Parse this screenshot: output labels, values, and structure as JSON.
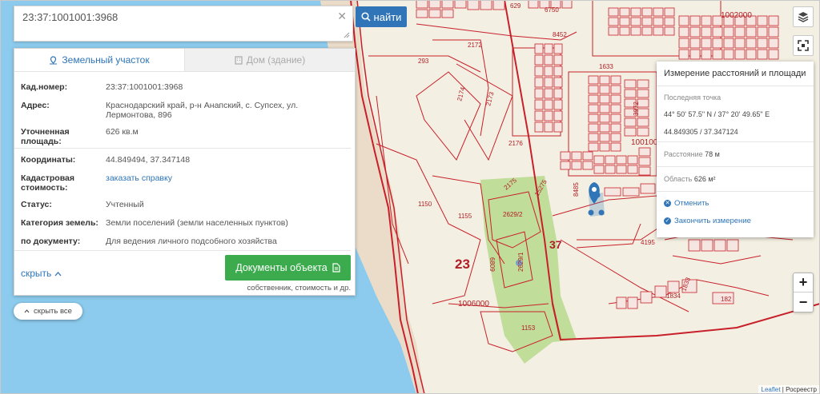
{
  "search": {
    "value": "23:37:1001001:3968",
    "button_label": "найти"
  },
  "tabs": {
    "parcel": "Земельный участок",
    "building": "Дом (здание)"
  },
  "parcel": {
    "cad_label": "Кад.номер:",
    "cad_value": "23:37:1001001:3968",
    "address_label": "Адрес:",
    "address_value": "Краснодарский край, р-н Анапский, с. Супсех, ул. Лермонтова, 896",
    "area_label": "Уточненная площадь:",
    "area_value": "626 кв.м",
    "coords_label": "Координаты:",
    "coords_value": "44.849494, 37.347148",
    "cost_label": "Кадастровая стоимость:",
    "cost_value": "заказать справку",
    "status_label": "Статус:",
    "status_value": "Учтенный",
    "category_label": "Категория земель:",
    "category_value": "Земли поселений (земли населенных пунктов)",
    "doc_label": "по документу:",
    "doc_value": "Для ведения личного подсобного хозяйства"
  },
  "panel_actions": {
    "hide": "скрыть",
    "docs_button": "Документы объекта",
    "docs_sub": "собственник, стоимость и др."
  },
  "hide_all": "скрыть все",
  "measure": {
    "title": "Измерение расстояний и площади",
    "last_point_label": "Последняя точка",
    "last_point_dms": "44° 50' 57.5\" N / 37° 20' 49.65\" E",
    "last_point_dec": "44.849305 / 37.347124",
    "distance_label": "Расстояние",
    "distance_value": "78 м",
    "area_label": "Область",
    "area_value": "626 м²",
    "cancel": "Отменить",
    "finish": "Закончить измерение"
  },
  "map_labels": {
    "l2172": "2172",
    "l293": "293",
    "l2174": "2174",
    "l2173": "2173",
    "l2176": "2176",
    "l1633": "1633",
    "l1002000": "1002000",
    "l8452": "8452",
    "l1150": "1150",
    "l1155": "1155",
    "l2175": "2175",
    "l2629_2": "2629/2",
    "l2629_1": "2629/1",
    "l6809": "6809",
    "l23": "23",
    "l37": "37",
    "l1006000": "1006000",
    "l1153": "1153",
    "l4195": "4195",
    "l1834": "1834",
    "l1833": "1833",
    "l182": "182",
    "l100100": "100100",
    "l3972": "3972",
    "l15275": "15275",
    "l8485": "8485",
    "l629": "629",
    "l6750": "6750"
  },
  "attribution": {
    "leaflet": "Leaflet",
    "source": "Росреестр"
  },
  "colors": {
    "accent": "#2f75b8",
    "green": "#3bab4d",
    "parcel_line": "#c8202a",
    "water": "#86c9ec"
  }
}
